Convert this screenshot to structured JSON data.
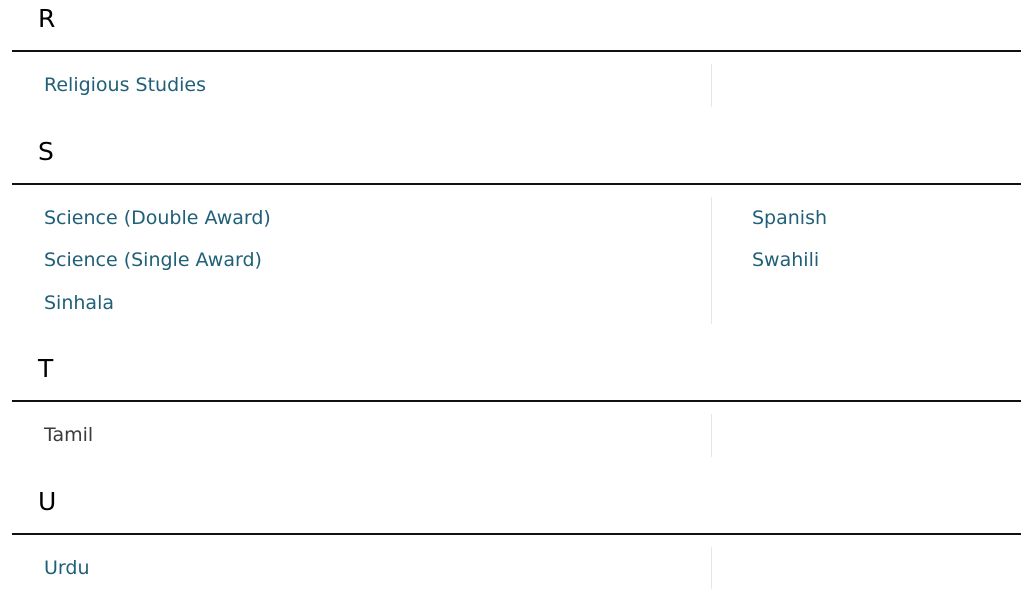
{
  "sections": [
    {
      "letter": "R",
      "left": [
        "Religious Studies"
      ],
      "right": []
    },
    {
      "letter": "S",
      "left": [
        "Science (Double Award)",
        "Science (Single Award)",
        "Sinhala"
      ],
      "right": [
        "Spanish",
        "Swahili"
      ]
    },
    {
      "letter": "T",
      "left": [
        "Tamil"
      ],
      "right": []
    },
    {
      "letter": "U",
      "left": [
        "Urdu"
      ],
      "right": []
    }
  ],
  "colors": {
    "link": "#1f5f78",
    "visited_link": "#3a3a3a",
    "divider": "#111111"
  }
}
